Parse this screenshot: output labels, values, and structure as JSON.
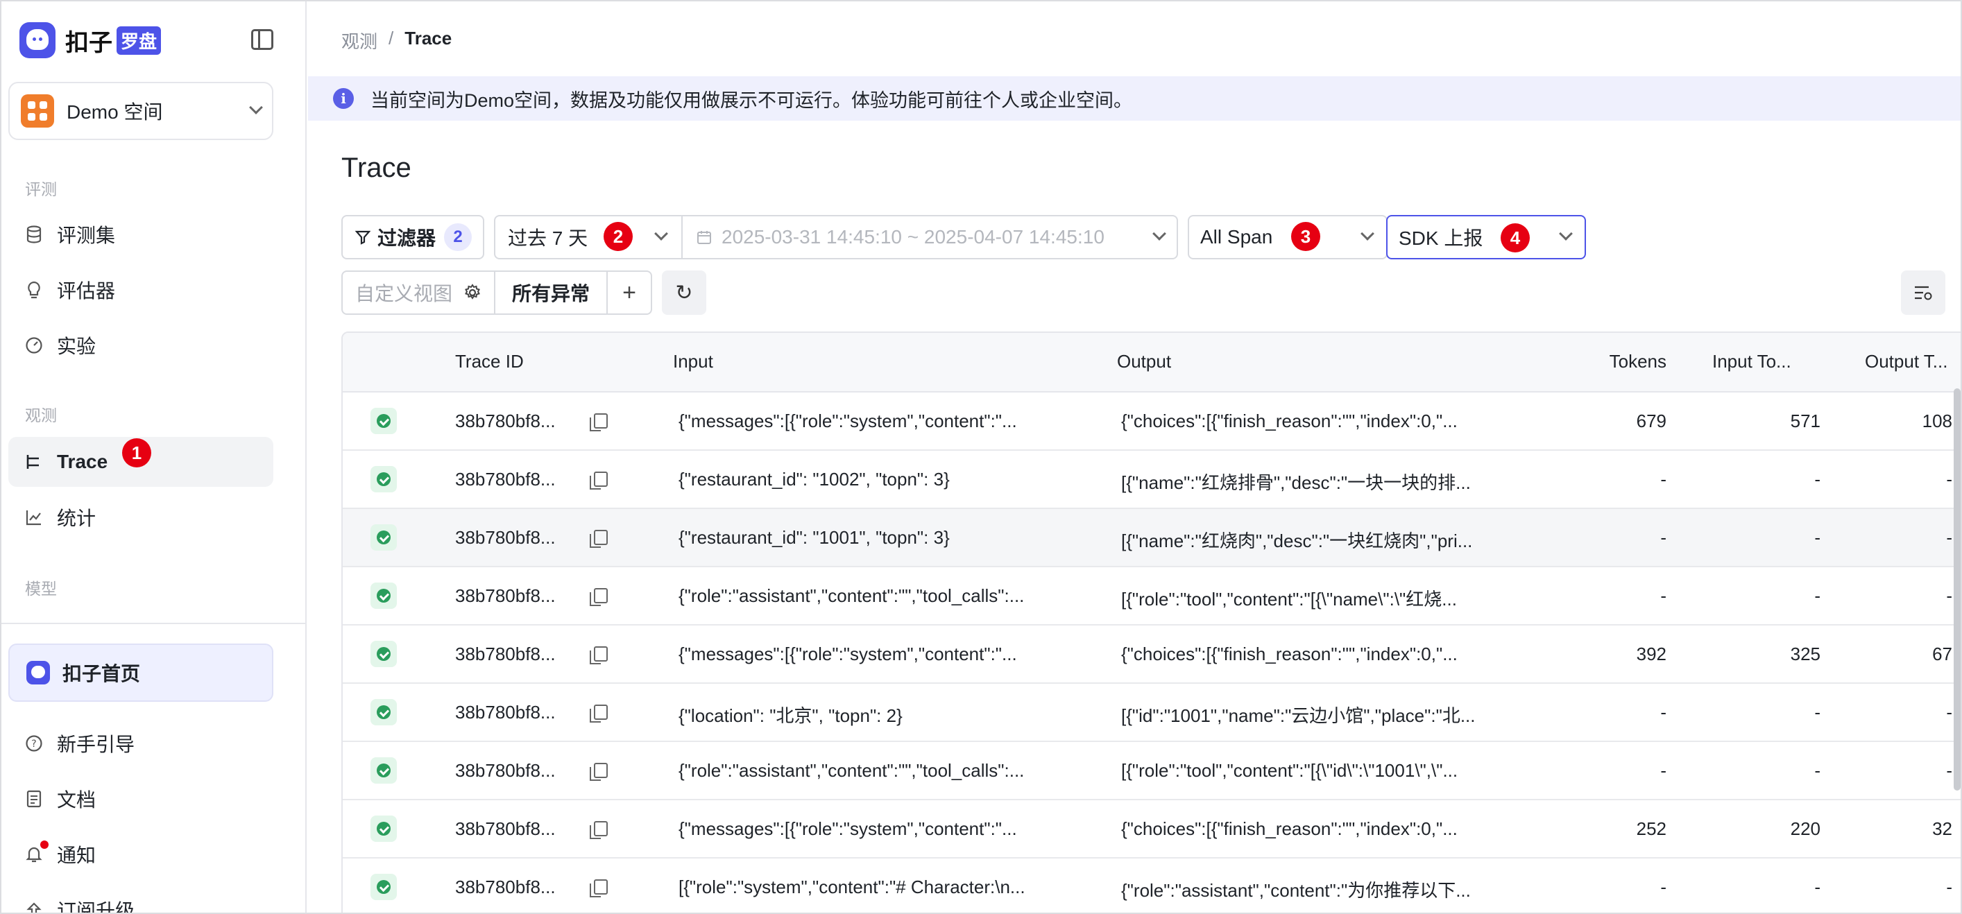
{
  "app": {
    "logo_text": "扣子",
    "logo_badge": "罗盘"
  },
  "space": {
    "name": "Demo 空间"
  },
  "sidebar": {
    "section_eval": "评测",
    "eval_items": [
      {
        "label": "评测集",
        "icon": "database-icon"
      },
      {
        "label": "评估器",
        "icon": "bulb-icon"
      },
      {
        "label": "实验",
        "icon": "gauge-icon"
      }
    ],
    "section_observe": "观测",
    "observe_items": [
      {
        "label": "Trace",
        "icon": "trace-icon",
        "active": true,
        "badge": "1"
      },
      {
        "label": "统计",
        "icon": "chart-icon"
      }
    ],
    "section_model": "模型",
    "home": "扣子首页",
    "bottom_items": [
      {
        "label": "新手引导",
        "icon": "help-icon"
      },
      {
        "label": "文档",
        "icon": "doc-icon"
      },
      {
        "label": "通知",
        "icon": "bell-icon"
      },
      {
        "label": "订阅升级",
        "icon": "upgrade-icon"
      }
    ]
  },
  "breadcrumb": {
    "parent": "观测",
    "sep": "/",
    "current": "Trace"
  },
  "banner": {
    "text": "当前空间为Demo空间，数据及功能仅用做展示不可运行。体验功能可前往个人或企业空间。"
  },
  "page": {
    "title": "Trace"
  },
  "toolbar": {
    "filter_label": "过滤器",
    "filter_count": "2",
    "period": "过去 7 天",
    "period_badge": "2",
    "date_range": "2025-03-31 14:45:10 ~ 2025-04-07 14:45:10",
    "span_type": "All Span",
    "span_badge": "3",
    "source": "SDK 上报",
    "source_badge": "4",
    "custom_view_placeholder": "自定义视图",
    "all_errors": "所有异常",
    "add": "+",
    "refresh": "↻"
  },
  "table": {
    "columns": [
      "Trace ID",
      "Input",
      "Output",
      "Tokens",
      "Input To...",
      "Output T..."
    ],
    "rows": [
      {
        "id": "38b780bf8...",
        "input": "{\"messages\":[{\"role\":\"system\",\"content\":\"...",
        "output": "{\"choices\":[{\"finish_reason\":\"\",\"index\":0,\"...",
        "tokens": "679",
        "input_tokens": "571",
        "output_tokens": "108"
      },
      {
        "id": "38b780bf8...",
        "input": "{\"restaurant_id\": \"1002\", \"topn\": 3}",
        "output": "[{\"name\":\"红烧排骨\",\"desc\":\"一块一块的排...",
        "tokens": "-",
        "input_tokens": "-",
        "output_tokens": "-"
      },
      {
        "id": "38b780bf8...",
        "input": "{\"restaurant_id\": \"1001\", \"topn\": 3}",
        "output": "[{\"name\":\"红烧肉\",\"desc\":\"一块红烧肉\",\"pri...",
        "tokens": "-",
        "input_tokens": "-",
        "output_tokens": "-"
      },
      {
        "id": "38b780bf8...",
        "input": "{\"role\":\"assistant\",\"content\":\"\",\"tool_calls\":...",
        "output": "[{\"role\":\"tool\",\"content\":\"[{\\\"name\\\":\\\"红烧...",
        "tokens": "-",
        "input_tokens": "-",
        "output_tokens": "-"
      },
      {
        "id": "38b780bf8...",
        "input": "{\"messages\":[{\"role\":\"system\",\"content\":\"...",
        "output": "{\"choices\":[{\"finish_reason\":\"\",\"index\":0,\"...",
        "tokens": "392",
        "input_tokens": "325",
        "output_tokens": "67"
      },
      {
        "id": "38b780bf8...",
        "input": "{\"location\": \"北京\", \"topn\": 2}",
        "output": "[{\"id\":\"1001\",\"name\":\"云边小馆\",\"place\":\"北...",
        "tokens": "-",
        "input_tokens": "-",
        "output_tokens": "-"
      },
      {
        "id": "38b780bf8...",
        "input": "{\"role\":\"assistant\",\"content\":\"\",\"tool_calls\":...",
        "output": "[{\"role\":\"tool\",\"content\":\"[{\\\"id\\\":\\\"1001\\\",\\\"...",
        "tokens": "-",
        "input_tokens": "-",
        "output_tokens": "-"
      },
      {
        "id": "38b780bf8...",
        "input": "{\"messages\":[{\"role\":\"system\",\"content\":\"...",
        "output": "{\"choices\":[{\"finish_reason\":\"\",\"index\":0,\"...",
        "tokens": "252",
        "input_tokens": "220",
        "output_tokens": "32"
      },
      {
        "id": "38b780bf8...",
        "input": "[{\"role\":\"system\",\"content\":\"# Character:\\n...",
        "output": "{\"role\":\"assistant\",\"content\":\"为你推荐以下...",
        "tokens": "-",
        "input_tokens": "-",
        "output_tokens": "-"
      }
    ]
  },
  "colors": {
    "accent": "#4d53e8",
    "badge": "#e60012",
    "success": "#2a9d5c"
  }
}
